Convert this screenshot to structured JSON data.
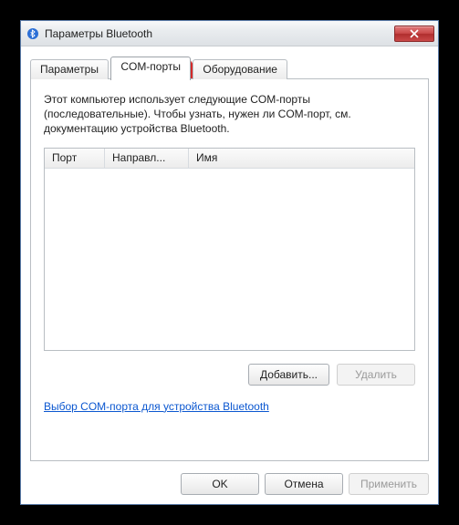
{
  "window": {
    "title": "Параметры Bluetooth"
  },
  "tabs": {
    "params": "Параметры",
    "com": "COM-порты",
    "hw": "Оборудование"
  },
  "panel": {
    "description": "Этот компьютер использует следующие COM-порты (последовательные). Чтобы узнать, нужен ли COM-порт, см. документацию устройства Bluetooth.",
    "columns": {
      "port": "Порт",
      "direction": "Направл...",
      "name": "Имя"
    },
    "buttons": {
      "add": "Добавить...",
      "remove": "Удалить"
    },
    "link": "Выбор COM-порта для устройства Bluetooth"
  },
  "dialog_buttons": {
    "ok": "OK",
    "cancel": "Отмена",
    "apply": "Применить"
  }
}
